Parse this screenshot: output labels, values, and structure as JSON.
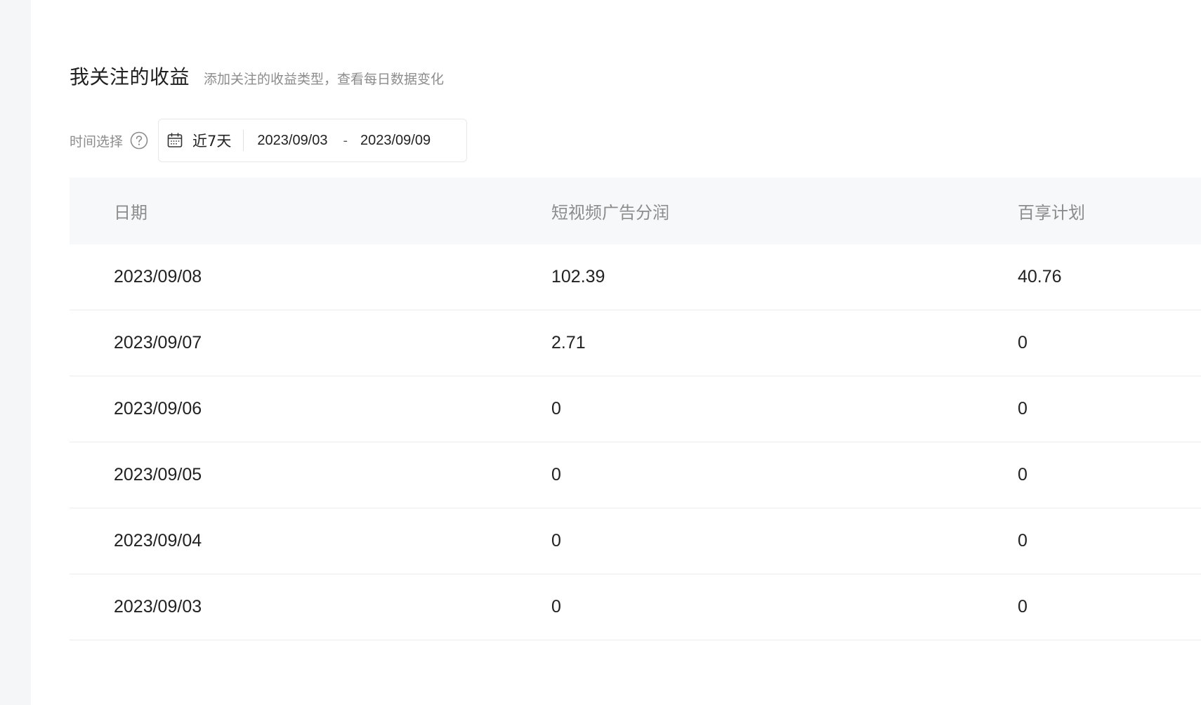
{
  "header": {
    "title": "我关注的收益",
    "subtitle": "添加关注的收益类型，查看每日数据变化"
  },
  "filter": {
    "label": "时间选择",
    "help_icon": "question-circle-icon",
    "calendar_icon": "calendar-icon",
    "preset": "近7天",
    "start_date": "2023/09/03",
    "separator": "-",
    "end_date": "2023/09/09"
  },
  "table": {
    "columns": [
      "日期",
      "短视频广告分润",
      "百享计划"
    ],
    "rows": [
      [
        "2023/09/08",
        "102.39",
        "40.76"
      ],
      [
        "2023/09/07",
        "2.71",
        "0"
      ],
      [
        "2023/09/06",
        "0",
        "0"
      ],
      [
        "2023/09/05",
        "0",
        "0"
      ],
      [
        "2023/09/04",
        "0",
        "0"
      ],
      [
        "2023/09/03",
        "0",
        "0"
      ]
    ]
  },
  "colors": {
    "rail_bg": "#f5f6f8",
    "header_bg": "#f7f8fa",
    "muted_text": "#8c8c8c",
    "border": "#ececec"
  }
}
